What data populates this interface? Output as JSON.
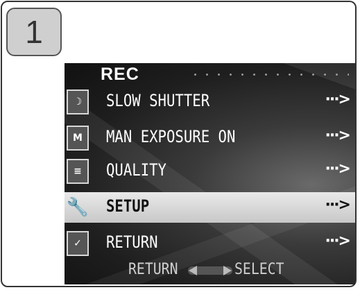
{
  "step_number": "1",
  "menu": {
    "title": "REC",
    "items": [
      {
        "label": "SLOW SHUTTER",
        "icon": "slow-shutter-icon",
        "glyph": "☽",
        "arrow": "···>",
        "selected": false
      },
      {
        "label": "MAN EXPOSURE ON",
        "icon": "manual-exposure-icon",
        "glyph": "M",
        "arrow": "···>",
        "selected": false
      },
      {
        "label": "QUALITY",
        "icon": "quality-icon",
        "glyph": "≡",
        "arrow": "···>",
        "selected": false
      },
      {
        "label": "SETUP",
        "icon": "setup-tools-icon",
        "glyph": "🔧",
        "arrow": "···>",
        "selected": true
      },
      {
        "label": "RETURN",
        "icon": "return-checklist-icon",
        "glyph": "✓",
        "arrow": "···>",
        "selected": false
      }
    ],
    "footer": {
      "left": "RETURN",
      "right": "SELECT"
    }
  }
}
